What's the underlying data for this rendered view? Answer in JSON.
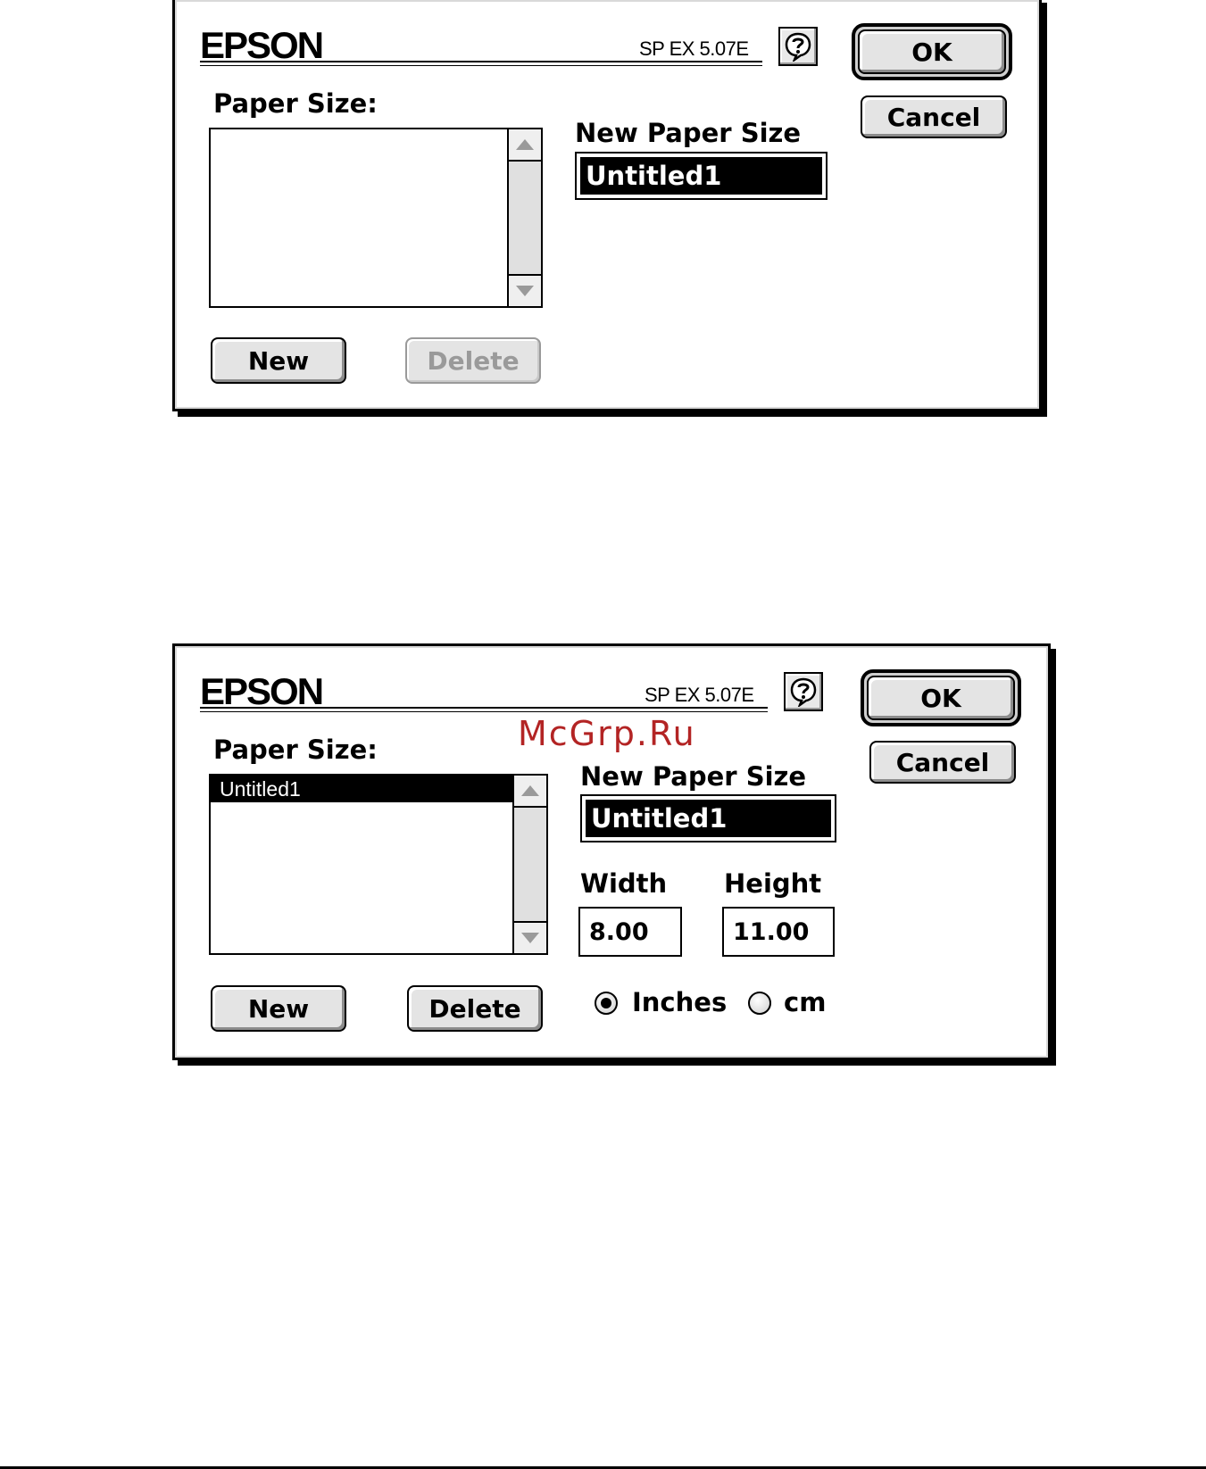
{
  "dialog1": {
    "brand": "EPSON",
    "version": "SP EX 5.07E",
    "paper_size_label": "Paper Size:",
    "list_items": [],
    "new_paper_size_label": "New Paper Size",
    "new_paper_size_value": "Untitled1",
    "buttons": {
      "ok": "OK",
      "cancel": "Cancel",
      "new": "New",
      "delete": "Delete"
    },
    "delete_disabled": true
  },
  "dialog2": {
    "brand": "EPSON",
    "version": "SP EX 5.07E",
    "paper_size_label": "Paper Size:",
    "list_items": [
      "Untitled1"
    ],
    "new_paper_size_label": "New Paper Size",
    "new_paper_size_value": "Untitled1",
    "width_label": "Width",
    "width_value": "8.00",
    "height_label": "Height",
    "height_value": "11.00",
    "units": {
      "inches_label": "Inches",
      "cm_label": "cm",
      "selected": "inches"
    },
    "buttons": {
      "ok": "OK",
      "cancel": "Cancel",
      "new": "New",
      "delete": "Delete"
    },
    "delete_disabled": false
  },
  "watermark": "McGrp.Ru",
  "colors": {
    "watermark": "#b32424",
    "selection": "#000000",
    "button_face": "#e4e4e4"
  },
  "icons": {
    "help": "help-balloon-icon",
    "scroll_up": "arrow-up-icon",
    "scroll_down": "arrow-down-icon"
  }
}
